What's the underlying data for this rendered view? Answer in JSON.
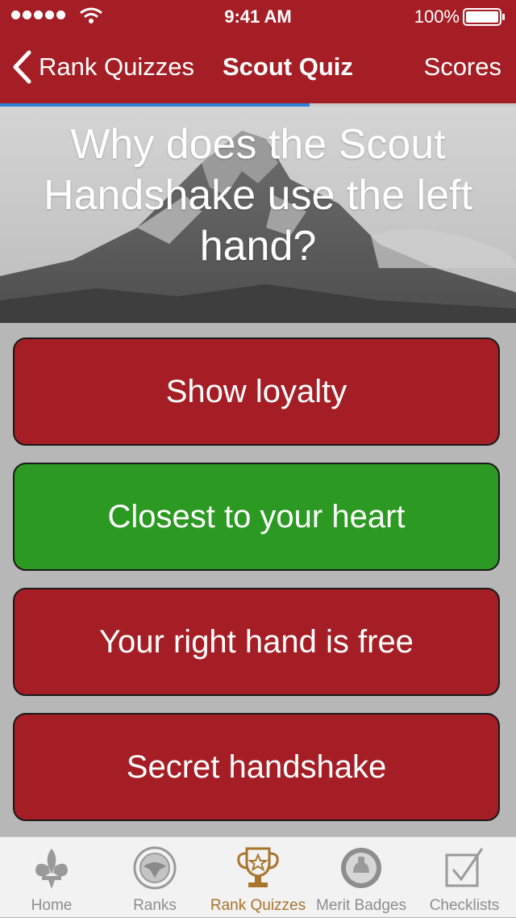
{
  "status_bar": {
    "time": "9:41 AM",
    "battery": "100%",
    "icons": [
      "signal-dots-icon",
      "wifi-icon",
      "battery-icon"
    ]
  },
  "nav": {
    "back_label": "Rank Quizzes",
    "title": "Scout Quiz",
    "scores_label": "Scores",
    "progress": 0.6,
    "colors": {
      "bar": "#a51e25",
      "progress": "#2f7fd6"
    }
  },
  "question": {
    "text": "Why does the Scout Handshake use the left hand?"
  },
  "answers": [
    {
      "label": "Show loyalty",
      "state": "red"
    },
    {
      "label": "Closest to your heart",
      "state": "green"
    },
    {
      "label": "Your right hand is free",
      "state": "red"
    },
    {
      "label": "Secret handshake",
      "state": "red"
    }
  ],
  "answer_colors": {
    "red": "#a51e25",
    "green": "#2c9a22"
  },
  "tabs": [
    {
      "label": "Home",
      "icon": "fleur-de-lis-icon",
      "active": false
    },
    {
      "label": "Ranks",
      "icon": "eagle-badge-icon",
      "active": false
    },
    {
      "label": "Rank Quizzes",
      "icon": "trophy-icon",
      "active": true
    },
    {
      "label": "Merit Badges",
      "icon": "merit-badge-icon",
      "active": false
    },
    {
      "label": "Checklists",
      "icon": "checkbox-icon",
      "active": false
    }
  ],
  "tab_colors": {
    "active": "#a8742c",
    "inactive": "#8e8e8e"
  }
}
